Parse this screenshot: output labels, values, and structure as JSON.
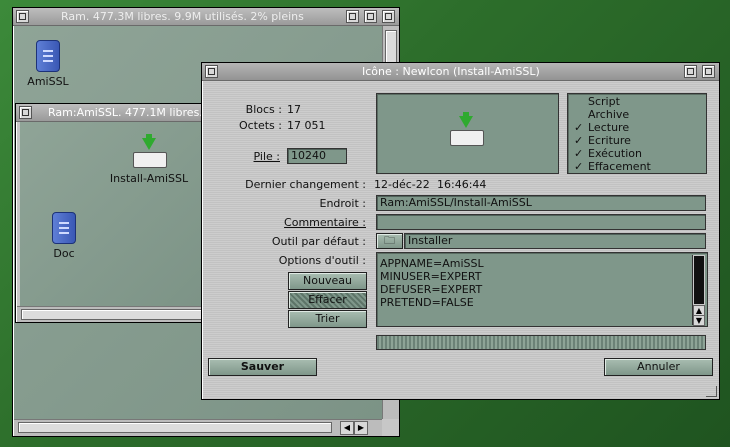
{
  "win_ram": {
    "title": "Ram.  477.3M libres. 9.9M utilisés. 2% pleins",
    "icon_label": "AmiSSL"
  },
  "win_amissl": {
    "title": "Ram:AmiSSL.  477.1M libres.",
    "icons": [
      {
        "label": "Install-AmiSSL"
      },
      {
        "label": "Doc"
      }
    ]
  },
  "dialog": {
    "title": "Icône : NewIcon (Install-AmiSSL)",
    "blocs_label": "Blocs :",
    "blocs_value": "17",
    "octets_label": "Octets :",
    "octets_value": "17 051",
    "pile_label": "Pile :",
    "pile_value": "10240",
    "flags": [
      {
        "label": "Script",
        "checked": false
      },
      {
        "label": "Archive",
        "checked": false
      },
      {
        "label": "Lecture",
        "checked": true
      },
      {
        "label": "Ecriture",
        "checked": true
      },
      {
        "label": "Exécution",
        "checked": true
      },
      {
        "label": "Effacement",
        "checked": true
      }
    ],
    "changed_label": "Dernier changement :",
    "changed_date": "12-déc-22",
    "changed_time": "16:46:44",
    "endroit_label": "Endroit :",
    "endroit_value": "Ram:AmiSSL/Install-AmiSSL",
    "comment_label": "Commentaire :",
    "comment_value": "",
    "tool_label": "Outil par défaut :",
    "tool_value": "Installer",
    "tooltypes_label": "Options d'outil :",
    "tooltypes": [
      "APPNAME=AmiSSL",
      "MINUSER=EXPERT",
      "DEFUSER=EXPERT",
      "PRETEND=FALSE"
    ],
    "btn_nouveau": "Nouveau",
    "btn_effacer": "Effacer",
    "btn_trier": "Trier",
    "btn_save": "Sauver",
    "btn_cancel": "Annuler"
  }
}
